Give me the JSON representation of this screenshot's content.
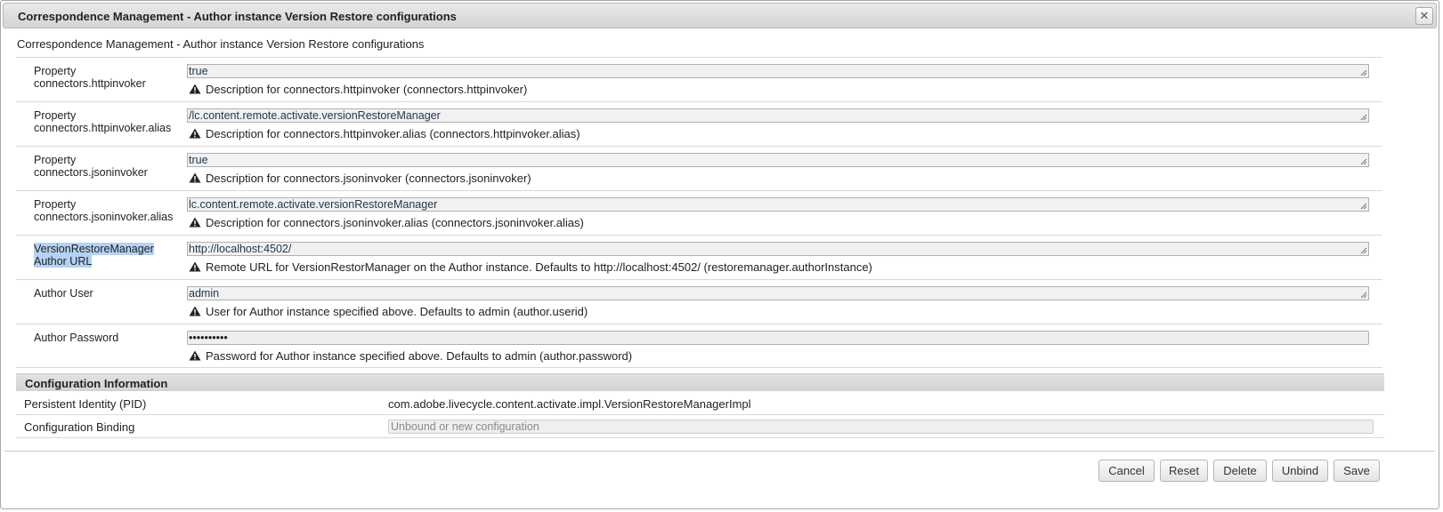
{
  "dialog": {
    "title": "Correspondence Management - Author instance Version Restore configurations",
    "close_glyph": "✕",
    "subtitle": "Correspondence Management - Author instance Version Restore configurations"
  },
  "properties": [
    {
      "label": "Property connectors.httpinvoker",
      "value": "true",
      "description": "Description for connectors.httpinvoker (connectors.httpinvoker)"
    },
    {
      "label": "Property connectors.httpinvoker.alias",
      "value": "/lc.content.remote.activate.versionRestoreManager",
      "description": "Description for connectors.httpinvoker.alias (connectors.httpinvoker.alias)"
    },
    {
      "label": "Property connectors.jsoninvoker",
      "value": "true",
      "description": "Description for connectors.jsoninvoker (connectors.jsoninvoker)"
    },
    {
      "label": "Property connectors.jsoninvoker.alias",
      "value": "lc.content.remote.activate.versionRestoreManager",
      "description": "Description for connectors.jsoninvoker.alias (connectors.jsoninvoker.alias)"
    },
    {
      "label": "VersionRestoreManager Author URL",
      "value": "http://localhost:4502/",
      "description": "Remote URL for VersionRestorManager on the Author instance. Defaults to http://localhost:4502/ (restoremanager.authorInstance)"
    },
    {
      "label": "Author User",
      "value": "admin",
      "description": "User for Author instance specified above. Defaults to admin (author.userid)"
    },
    {
      "label": "Author Password",
      "value": "••••••••••",
      "description": "Password for Author instance specified above. Defaults to admin (author.password)"
    }
  ],
  "config_info": {
    "header": "Configuration Information",
    "pid_label": "Persistent Identity (PID)",
    "pid_value": "com.adobe.livecycle.content.activate.impl.VersionRestoreManagerImpl",
    "binding_label": "Configuration Binding",
    "binding_placeholder": "Unbound or new configuration"
  },
  "buttons": {
    "cancel": "Cancel",
    "reset": "Reset",
    "delete": "Delete",
    "unbind": "Unbind",
    "save": "Save"
  },
  "icons": {
    "warning": "warning-icon",
    "close": "close-icon",
    "resize": "resize-grip-icon"
  }
}
